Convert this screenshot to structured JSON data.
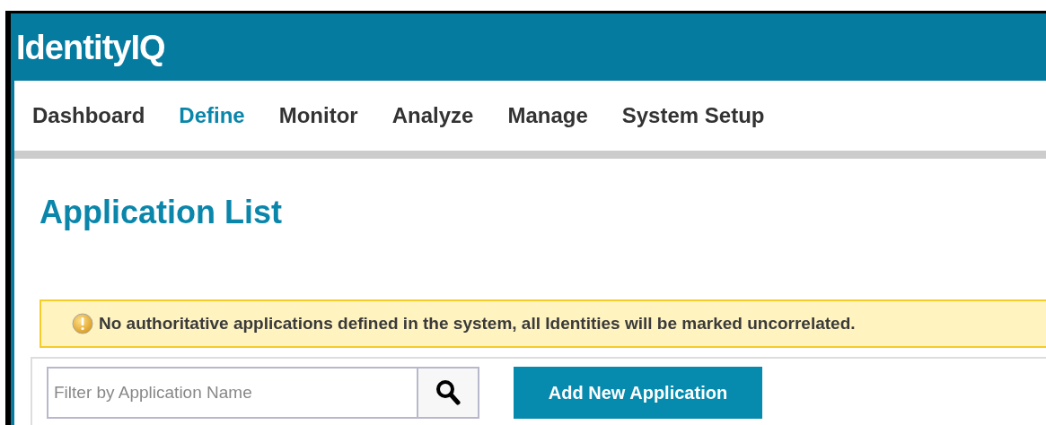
{
  "header": {
    "logo": "IdentityIQ"
  },
  "nav": [
    {
      "label": "Dashboard",
      "selected": false
    },
    {
      "label": "Define",
      "selected": true
    },
    {
      "label": "Monitor",
      "selected": false
    },
    {
      "label": "Analyze",
      "selected": false
    },
    {
      "label": "Manage",
      "selected": false
    },
    {
      "label": "System Setup",
      "selected": false
    }
  ],
  "page_title": "Application List",
  "warning": {
    "message": "No authoritative applications defined in the system, all Identities will be marked uncorrelated."
  },
  "filter": {
    "placeholder": "Filter by Application Name"
  },
  "add_button": "Add New Application"
}
